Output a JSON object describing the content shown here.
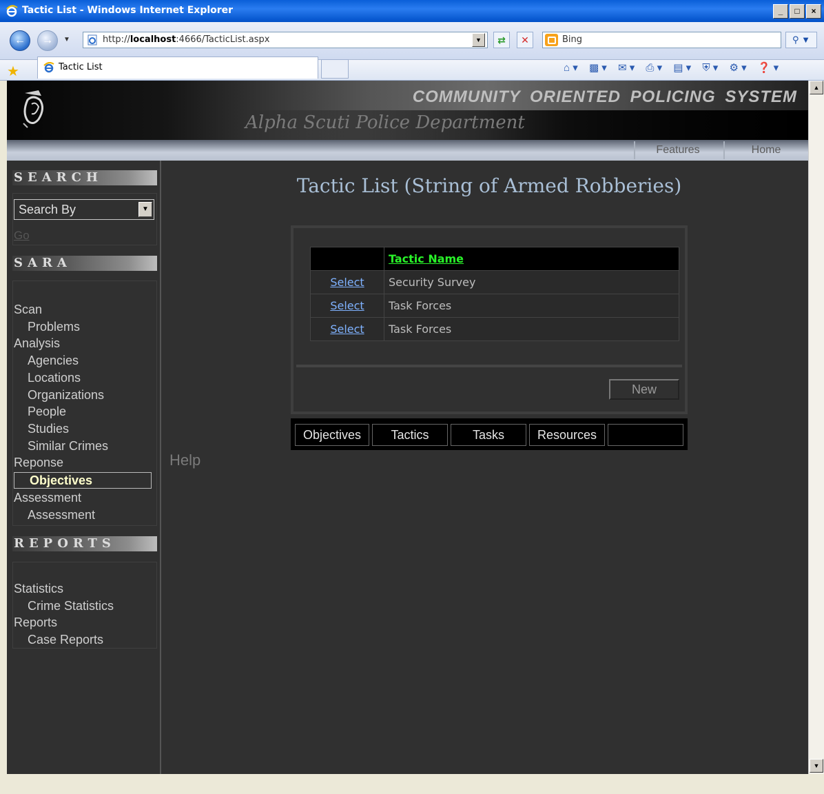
{
  "window": {
    "title": "Tactic List - Windows Internet Explorer",
    "min_label": "_",
    "max_label": "□",
    "close_label": "×"
  },
  "browser": {
    "url_prefix": "http://",
    "url_host": "localhost",
    "url_rest": ":4666/TacticList.aspx",
    "search_engine": "Bing",
    "tab_title": "Tactic List"
  },
  "site": {
    "system_title": "COMMUNITY ORIENTED POLICING SYSTEM",
    "department": "Alpha Scuti Police Department",
    "nav": [
      "Features",
      "Home"
    ]
  },
  "sidebar": {
    "search_heading": "SEARCH",
    "search_select": "Search By",
    "go_label": "Go",
    "sara_heading": "SARA",
    "sara_items": [
      {
        "label": "Scan",
        "level": 0
      },
      {
        "label": "Problems",
        "level": 1
      },
      {
        "label": "Analysis",
        "level": 0
      },
      {
        "label": "Agencies",
        "level": 1
      },
      {
        "label": "Locations",
        "level": 1
      },
      {
        "label": "Organizations",
        "level": 1
      },
      {
        "label": "People",
        "level": 1
      },
      {
        "label": "Studies",
        "level": 1
      },
      {
        "label": "Similar Crimes",
        "level": 1
      },
      {
        "label": "Reponse",
        "level": 0
      },
      {
        "label": "Objectives",
        "level": 1,
        "selected": true
      },
      {
        "label": "Assessment",
        "level": 0
      },
      {
        "label": "Assessment",
        "level": 1
      }
    ],
    "reports_heading": "REPORTS",
    "reports_items": [
      {
        "label": "Statistics",
        "level": 0
      },
      {
        "label": "Crime Statistics",
        "level": 1
      },
      {
        "label": "Reports",
        "level": 0
      },
      {
        "label": "Case Reports",
        "level": 1
      }
    ],
    "help_label": "Help"
  },
  "main": {
    "page_title": "Tactic List (String of Armed Robberies)",
    "grid_header": "Tactic Name",
    "select_label": "Select",
    "rows": [
      "Security Survey",
      "Task Forces",
      "Task Forces"
    ],
    "new_button": "New",
    "tabs": [
      "Objectives",
      "Tactics",
      "Tasks",
      "Resources",
      ""
    ]
  },
  "colors": {
    "page_bg": "#303030",
    "header_link": "#29f229",
    "select_link": "#7fb2ff",
    "title": "#a9bfd6",
    "selected_menu": "#ffffcc"
  }
}
